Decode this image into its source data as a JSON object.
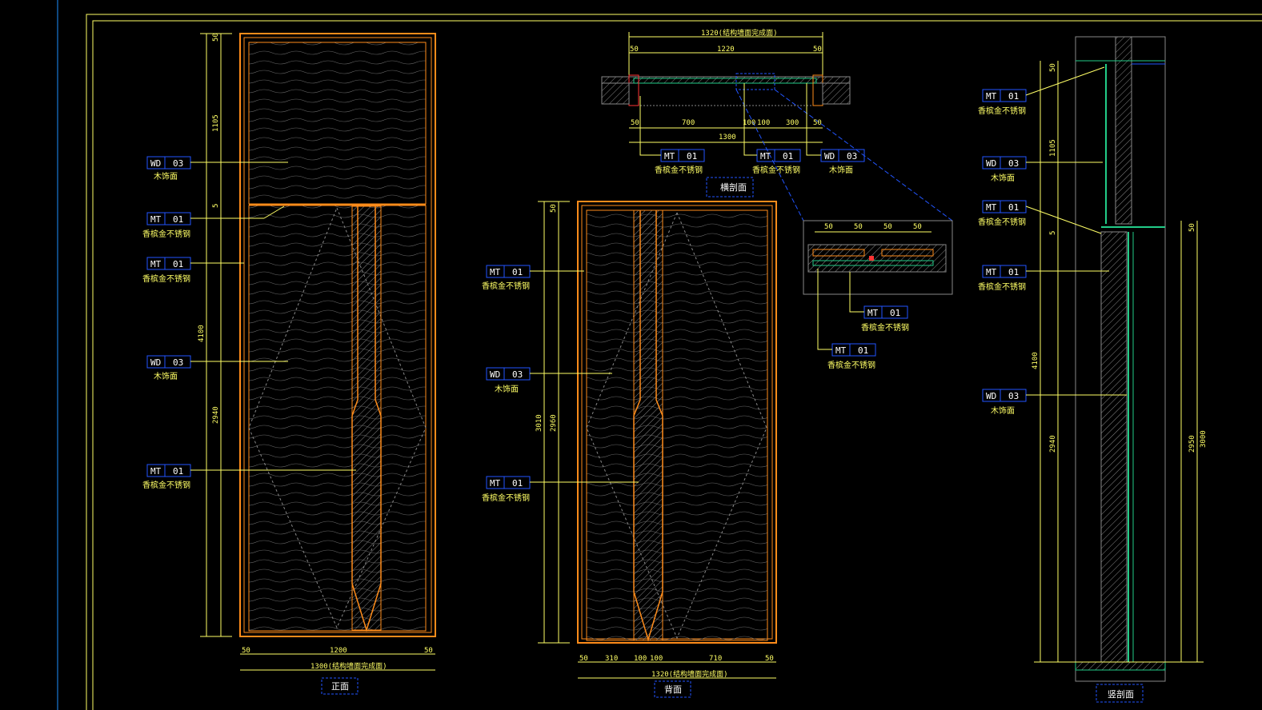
{
  "colors": {
    "background": "#000000",
    "frame": "#ffff66",
    "door_edge": "#ff8c1a",
    "tag_box": "#2255ff",
    "tag_text": "#ffffff",
    "annotation": "#ffff66",
    "glass": "#22cc88",
    "hatch": "#888888"
  },
  "views": {
    "front": {
      "title": "正面",
      "dims_vertical": [
        "50",
        "1105",
        "5",
        "4100",
        "2940"
      ],
      "dims_horizontal": [
        "50",
        "1200",
        "50",
        "1300(结构墙面完成面)"
      ],
      "tags": [
        {
          "code": "WD",
          "num": "03",
          "desc": "木饰面"
        },
        {
          "code": "MT",
          "num": "01",
          "desc": "香槟金不锈钢"
        },
        {
          "code": "MT",
          "num": "01",
          "desc": "香槟金不锈钢"
        },
        {
          "code": "WD",
          "num": "03",
          "desc": "木饰面"
        },
        {
          "code": "MT",
          "num": "01",
          "desc": "香槟金不锈钢"
        }
      ]
    },
    "back": {
      "title": "背面",
      "dims_vertical": [
        "50",
        "3010",
        "2960"
      ],
      "dims_horizontal": [
        "50",
        "310",
        "100",
        "100",
        "710",
        "50",
        "1320(结构墙面完成面)"
      ],
      "tags": [
        {
          "code": "MT",
          "num": "01",
          "desc": "香槟金不锈钢"
        },
        {
          "code": "WD",
          "num": "03",
          "desc": "木饰面"
        },
        {
          "code": "MT",
          "num": "01",
          "desc": "香槟金不锈钢"
        }
      ]
    },
    "plan": {
      "title": "横剖面",
      "dims_top": [
        "1320(结构墙面完成面)",
        "50",
        "1220",
        "50"
      ],
      "dims_bottom": [
        "50",
        "700",
        "100",
        "100",
        "300",
        "50",
        "1300"
      ],
      "tags": [
        {
          "code": "MT",
          "num": "01",
          "desc": "香槟金不锈钢"
        },
        {
          "code": "MT",
          "num": "01",
          "desc": "香槟金不锈钢"
        },
        {
          "code": "WD",
          "num": "03",
          "desc": "木饰面"
        }
      ]
    },
    "detail": {
      "dims": [
        "50",
        "50",
        "50",
        "50"
      ],
      "tags": [
        {
          "code": "MT",
          "num": "01",
          "desc": "香槟金不锈钢"
        },
        {
          "code": "MT",
          "num": "01",
          "desc": "香槟金不锈钢"
        }
      ]
    },
    "section": {
      "title": "竖剖面",
      "dims_left": [
        "50",
        "1105",
        "5",
        "4100",
        "2940"
      ],
      "dims_right": [
        "50",
        "2950",
        "3000"
      ],
      "tags": [
        {
          "code": "MT",
          "num": "01",
          "desc": "香槟金不锈钢"
        },
        {
          "code": "WD",
          "num": "03",
          "desc": "木饰面"
        },
        {
          "code": "MT",
          "num": "01",
          "desc": "香槟金不锈钢"
        },
        {
          "code": "MT",
          "num": "01",
          "desc": "香槟金不锈钢"
        },
        {
          "code": "WD",
          "num": "03",
          "desc": "木饰面"
        }
      ]
    }
  }
}
